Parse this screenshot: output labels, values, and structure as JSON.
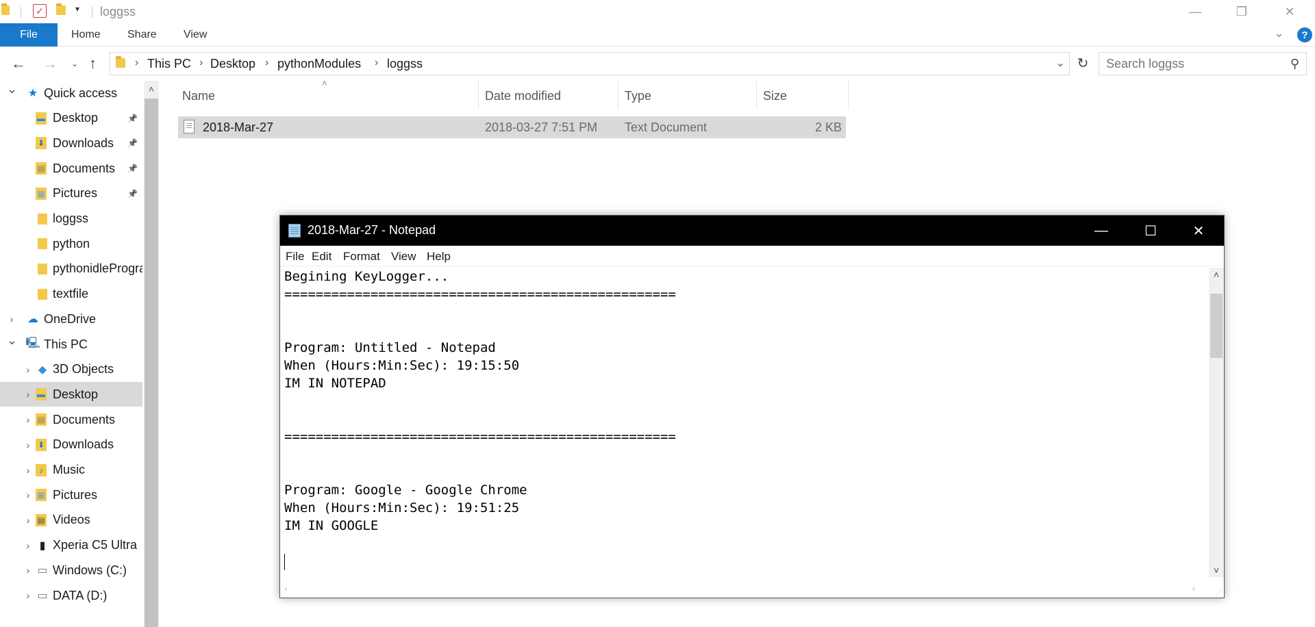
{
  "titlebar": {
    "title": "loggss",
    "controls": {
      "minimize": "—",
      "maximize": "❐",
      "close": "✕"
    }
  },
  "ribbon": {
    "file_tab": "File",
    "tabs": [
      "Home",
      "Share",
      "View"
    ],
    "help": "?"
  },
  "address": {
    "crumbs": [
      "This PC",
      "Desktop",
      "pythonModules",
      "loggss"
    ]
  },
  "search": {
    "placeholder": "Search loggss"
  },
  "navpane": {
    "items": [
      {
        "label": "Quick access",
        "icon": "star-icon",
        "level": 0,
        "arrow": "expanded"
      },
      {
        "label": "Desktop",
        "icon": "desktop-folder-icon",
        "level": 1,
        "pinned": true
      },
      {
        "label": "Downloads",
        "icon": "downloads-folder-icon",
        "level": 1,
        "pinned": true
      },
      {
        "label": "Documents",
        "icon": "documents-folder-icon",
        "level": 1,
        "pinned": true
      },
      {
        "label": "Pictures",
        "icon": "pictures-folder-icon",
        "level": 1,
        "pinned": true
      },
      {
        "label": "loggss",
        "icon": "folder-icon",
        "level": 1
      },
      {
        "label": "python",
        "icon": "folder-icon",
        "level": 1
      },
      {
        "label": "pythonidleProgra",
        "icon": "folder-icon",
        "level": 1
      },
      {
        "label": "textfile",
        "icon": "folder-icon",
        "level": 1
      },
      {
        "label": "OneDrive",
        "icon": "cloud-icon",
        "level": 0,
        "arrow": "collapsed"
      },
      {
        "label": "This PC",
        "icon": "computer-icon",
        "level": 0,
        "arrow": "expanded"
      },
      {
        "label": "3D Objects",
        "icon": "3d-objects-icon",
        "level": 1,
        "arrow": "collapsed"
      },
      {
        "label": "Desktop",
        "icon": "desktop-folder-icon",
        "level": 1,
        "arrow": "collapsed",
        "selected": true
      },
      {
        "label": "Documents",
        "icon": "documents-folder-icon",
        "level": 1,
        "arrow": "collapsed"
      },
      {
        "label": "Downloads",
        "icon": "downloads-folder-icon",
        "level": 1,
        "arrow": "collapsed"
      },
      {
        "label": "Music",
        "icon": "music-folder-icon",
        "level": 1,
        "arrow": "collapsed"
      },
      {
        "label": "Pictures",
        "icon": "pictures-folder-icon",
        "level": 1,
        "arrow": "collapsed"
      },
      {
        "label": "Videos",
        "icon": "videos-folder-icon",
        "level": 1,
        "arrow": "collapsed"
      },
      {
        "label": "Xperia C5 Ultra",
        "icon": "phone-icon",
        "level": 1,
        "arrow": "collapsed"
      },
      {
        "label": "Windows (C:)",
        "icon": "drive-icon",
        "level": 1,
        "arrow": "collapsed"
      },
      {
        "label": "DATA (D:)",
        "icon": "drive-icon",
        "level": 1,
        "arrow": "collapsed"
      }
    ]
  },
  "filelist": {
    "columns": [
      "Name",
      "Date modified",
      "Type",
      "Size"
    ],
    "rows": [
      {
        "name": "2018-Mar-27",
        "date": "2018-03-27 7:51 PM",
        "type": "Text Document",
        "size": "2 KB"
      }
    ]
  },
  "notepad": {
    "title": "2018-Mar-27 - Notepad",
    "menu": [
      "File",
      "Edit",
      "Format",
      "View",
      "Help"
    ],
    "lines": [
      "Begining KeyLogger...",
      "==================================================",
      "",
      "",
      "Program: Untitled - Notepad",
      "When (Hours:Min:Sec): 19:15:50",
      "IM IN NOTEPAD",
      "",
      "",
      "==================================================",
      "",
      "",
      "Program: Google - Google Chrome",
      "When (Hours:Min:Sec): 19:51:25",
      "IM IN GOOGLE",
      ""
    ]
  }
}
